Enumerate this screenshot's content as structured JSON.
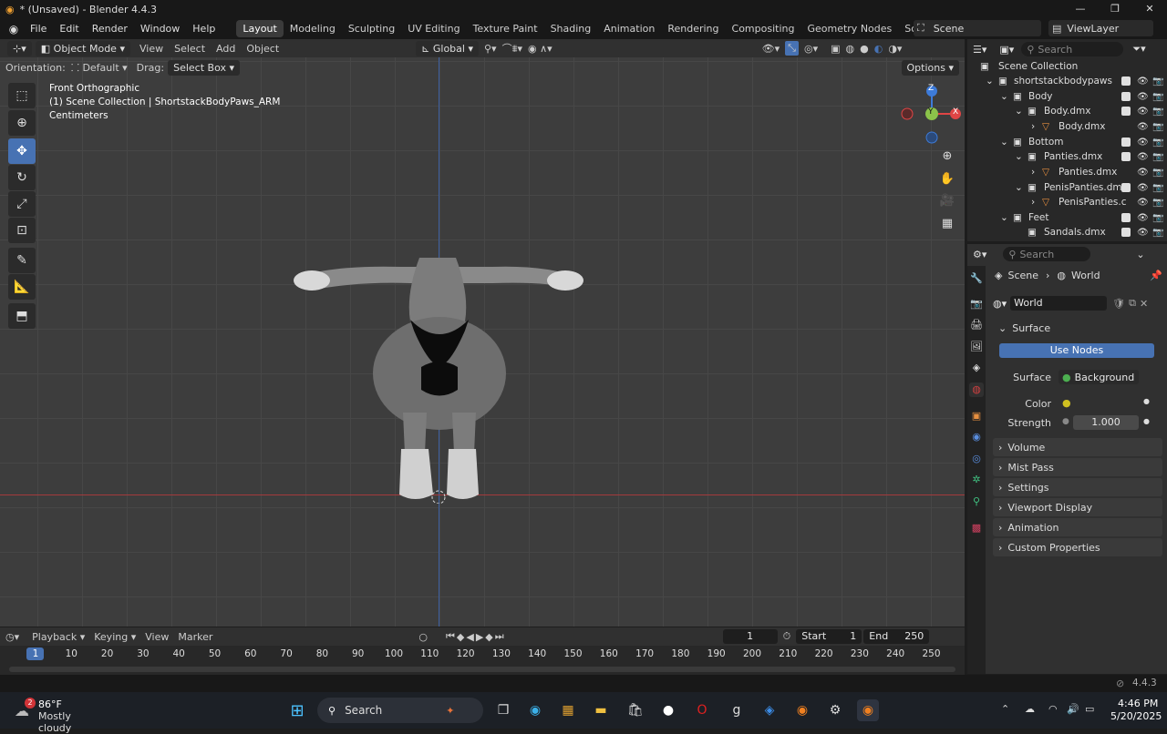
{
  "window": {
    "title": "* (Unsaved) - Blender 4.4.3",
    "min": "—",
    "max": "❐",
    "close": "✕"
  },
  "menu": [
    "File",
    "Edit",
    "Render",
    "Window",
    "Help"
  ],
  "workspaces": [
    "Layout",
    "Modeling",
    "Sculpting",
    "UV Editing",
    "Texture Paint",
    "Shading",
    "Animation",
    "Rendering",
    "Compositing",
    "Geometry Nodes",
    "Scripting"
  ],
  "scene": {
    "scene_name": "Scene",
    "view_layer": "ViewLayer"
  },
  "viewport_header": {
    "mode": "Object Mode",
    "menus": [
      "View",
      "Select",
      "Add",
      "Object"
    ],
    "transform": "Global"
  },
  "viewport_header2": {
    "orientation_label": "Orientation:",
    "orientation": "Default",
    "drag_label": "Drag:",
    "drag": "Select Box",
    "options": "Options"
  },
  "viewport_info": {
    "view": "Front Orthographic",
    "collection": "(1) Scene Collection | ShortstackBodyPaws_ARM",
    "units": "Centimeters"
  },
  "gizmo": {
    "z": "Z",
    "y": "Y",
    "x": "X"
  },
  "outliner": {
    "search_placeholder": "Search",
    "rows": [
      {
        "label": "Scene Collection"
      },
      {
        "label": "shortstackbodypaws"
      },
      {
        "label": "Body"
      },
      {
        "label": "Body.dmx"
      },
      {
        "label": "Body.dmx"
      },
      {
        "label": "Bottom"
      },
      {
        "label": "Panties.dmx"
      },
      {
        "label": "Panties.dmx"
      },
      {
        "label": "PenisPanties.dmx"
      },
      {
        "label": "PenisPanties.c"
      },
      {
        "label": "Feet"
      },
      {
        "label": "Sandals.dmx"
      }
    ]
  },
  "properties": {
    "search_placeholder": "Search",
    "breadcrumb_scene": "Scene",
    "breadcrumb_world": "World",
    "world_name": "World",
    "surface_panel": "Surface",
    "use_nodes": "Use Nodes",
    "surface_label": "Surface",
    "surface_value": "Background",
    "color_label": "Color",
    "strength_label": "Strength",
    "strength_value": "1.000",
    "panels": [
      "Volume",
      "Mist Pass",
      "Settings",
      "Viewport Display",
      "Animation",
      "Custom Properties"
    ]
  },
  "timeline": {
    "menus": [
      "Playback",
      "Keying",
      "View",
      "Marker"
    ],
    "current_frame": "1",
    "start_label": "Start",
    "start": "1",
    "end_label": "End",
    "end": "250",
    "ticks": [
      "1",
      "10",
      "20",
      "30",
      "40",
      "50",
      "60",
      "70",
      "80",
      "90",
      "100",
      "110",
      "120",
      "130",
      "140",
      "150",
      "160",
      "170",
      "180",
      "190",
      "200",
      "210",
      "220",
      "230",
      "240",
      "250"
    ]
  },
  "statusbar": {
    "version": "4.4.3"
  },
  "taskbar": {
    "weather_temp": "86°F",
    "weather_desc": "Mostly cloudy",
    "weather_badge": "2",
    "search": "Search",
    "time": "4:46 PM",
    "date": "5/20/2025"
  },
  "colors": {
    "accent": "#4772b3",
    "x_axis": "#e04545",
    "y_axis": "#8bc34a",
    "z_axis": "#3d7bd9",
    "timeline_red_line": "#c0393c",
    "blue_line": "#3d5fa0"
  }
}
